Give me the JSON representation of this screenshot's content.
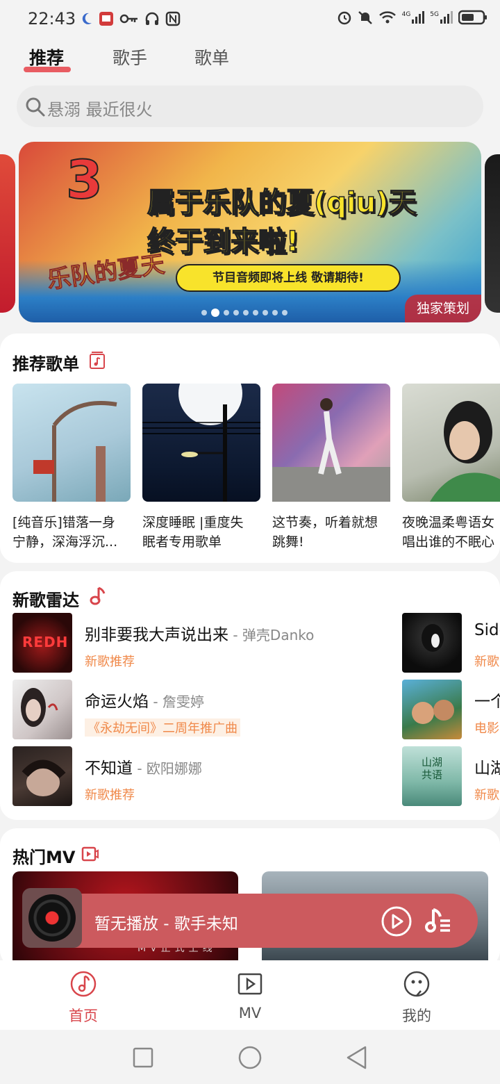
{
  "status_bar": {
    "time": "22:43",
    "signal_4g": "4G",
    "signal_5g": "5G"
  },
  "tabs": [
    {
      "label": "推荐",
      "active": true
    },
    {
      "label": "歌手",
      "active": false
    },
    {
      "label": "歌单",
      "active": false
    }
  ],
  "search": {
    "placeholder": "悬溺 最近很火"
  },
  "banner": {
    "number": "3",
    "title_line1": "属于乐队的夏(qiu)天",
    "title_line2": "终于到来啦!",
    "subtitle": "节目音频即将上线 敬请期待!",
    "logo_text": "乐队的夏天",
    "tag": "独家策划",
    "page_count": 9,
    "active_page": 1
  },
  "recommended_playlists": {
    "title": "推荐歌单",
    "items": [
      {
        "name": "[纯音乐]错落一身\n宁静，深海浮沉..."
      },
      {
        "name": "深度睡眠 |重度失\n眠者专用歌单"
      },
      {
        "name": "这节奏，听着就想\n跳舞!"
      },
      {
        "name": "夜晚温柔粤语女\n唱出谁的不眠心"
      }
    ]
  },
  "new_songs": {
    "title": "新歌雷达",
    "items": [
      {
        "title": "别非要我大声说出来",
        "artist": " - 弹壳Danko",
        "tag": "新歌推荐",
        "cover_text": "REDH"
      },
      {
        "title": "命运火焰",
        "artist": " - 詹雯婷",
        "tag": "《永劫无间》二周年推广曲",
        "cover_text": ""
      },
      {
        "title": "不知道",
        "artist": " - 欧阳娜娜",
        "tag": "新歌推荐",
        "cover_text": ""
      },
      {
        "title": "Side",
        "artist": "",
        "tag": "新歌",
        "cover_text": ""
      },
      {
        "title": "一个",
        "artist": "",
        "tag": "电影",
        "cover_text": ""
      },
      {
        "title": "山湖",
        "artist": "",
        "tag": "新歌",
        "cover_text": "山湖共语"
      }
    ]
  },
  "hot_mv": {
    "title": "热门MV",
    "mv1_caption": "MV正式上线"
  },
  "player": {
    "text": "暂无播放 - 歌手未知"
  },
  "bottom_nav": [
    {
      "label": "首页",
      "icon": "music-note-icon",
      "active": true
    },
    {
      "label": "MV",
      "icon": "video-play-icon",
      "active": false
    },
    {
      "label": "我的",
      "icon": "smiley-icon",
      "active": false
    }
  ],
  "colors": {
    "accent": "#d8454b",
    "tag_orange": "#f0894a",
    "player_bg": "#cc5a5e"
  }
}
